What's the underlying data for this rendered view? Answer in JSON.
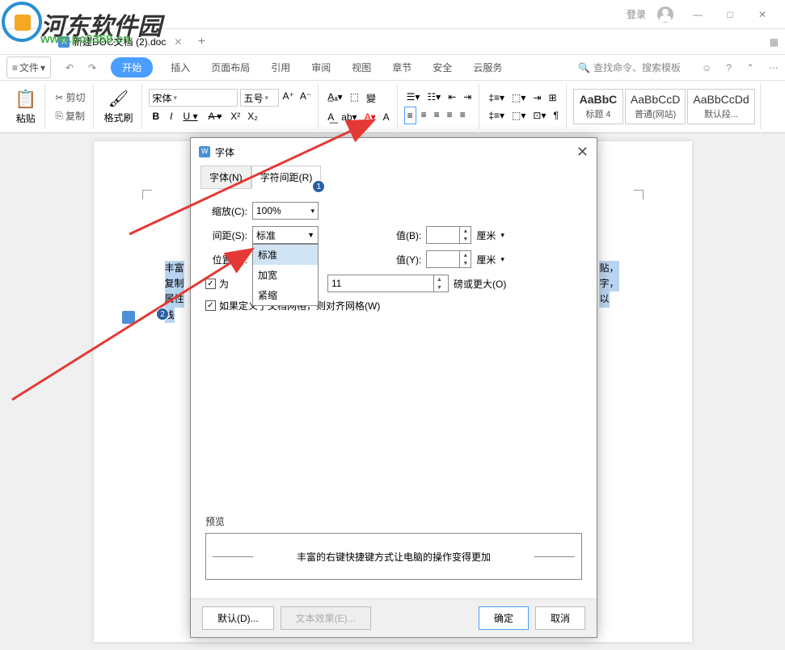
{
  "watermark": {
    "text1": "河东软件园",
    "text2": "www.pc0359.cn"
  },
  "titlebar": {
    "login": "登录"
  },
  "tabs": {
    "doc_title": "新建DOC文档 (2).doc"
  },
  "menubar": {
    "file": "文件",
    "start": "开始",
    "insert": "插入",
    "layout": "页面布局",
    "ref": "引用",
    "review": "审阅",
    "view": "视图",
    "chapter": "章节",
    "security": "安全",
    "cloud": "云服务",
    "search": "查找命令、搜索模板"
  },
  "ribbon": {
    "paste": "粘贴",
    "cut": "剪切",
    "copy": "复制",
    "format": "格式刷",
    "font_name": "宋体",
    "font_size": "五号",
    "style1_t": "AaBbC",
    "style1_s": "标题 4",
    "style2_t": "AaBbCcD",
    "style2_s": "普通(网站)",
    "style3_t": "AaBbCcDd",
    "style3_s": "默认段..."
  },
  "page": {
    "l1": "丰富",
    "l2": "复制",
    "l3": "属性",
    "l4": "栈",
    "side1": "贴，",
    "side2": "字，",
    "side3": "以"
  },
  "dialog": {
    "title": "字体",
    "tab1": "字体(N)",
    "tab2": "字符间距(R)",
    "scale_l": "缩放(C):",
    "scale_v": "100%",
    "spacing_l": "间距(S):",
    "spacing_v": "标准",
    "position_l": "位置(P):",
    "value_b": "值(B):",
    "value_y": "值(Y):",
    "cm": "厘米",
    "kerning_chk": "为",
    "kerning_v": "11",
    "kerning_suf": "磅或更大(O)",
    "grid_chk": "如果定义了文档网格，则对齐网格(W)",
    "dropdown": {
      "opt1": "标准",
      "opt2": "加宽",
      "opt3": "紧缩"
    },
    "preview_label": "预览",
    "preview_text": "丰富的右键快捷键方式让电脑的操作变得更加",
    "btn_default": "默认(D)...",
    "btn_effect": "文本效果(E)...",
    "btn_ok": "确定",
    "btn_cancel": "取消"
  }
}
